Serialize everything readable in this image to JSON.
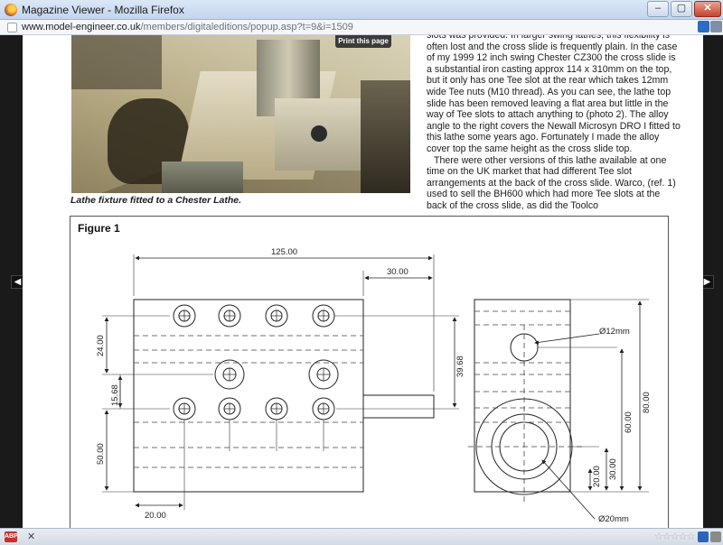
{
  "window": {
    "title": "Magazine Viewer - Mozilla Firefox",
    "minimize": "–",
    "maximize": "▢",
    "close": "✕"
  },
  "address": {
    "host": "www.model-engineer.co.uk",
    "path": "/members/digitaleditions/popup.asp?t=9&i=1509"
  },
  "viewer": {
    "prev_arrow": "◀",
    "next_arrow": "▶",
    "print_button": "Print this page",
    "photo_caption": "Lathe fixture fitted to a Chester Lathe.",
    "article_paragraphs": [
      "slots was provided. In larger swing lathes, this flexibility is often lost and the cross slide is frequently plain. In the case of my 1999 12 inch swing Chester CZ300 the cross slide is a substantial iron casting approx 114 x 310mm on the top, but it only has one Tee slot at the rear which takes 12mm wide Tee nuts (M10 thread). As you can see, the lathe top slide has been removed leaving a flat area but little in the way of Tee slots to attach anything to (photo 2). The alloy angle to the right covers the Newall Microsyn DRO I fitted to this lathe some years ago. Fortunately I made the alloy cover top the same height as the cross slide top.",
      "There were other versions of this lathe available at one time on the UK market that had different Tee slot arrangements at the back of the cross slide. Warco, (ref. 1) used to sell the BH600 which had more Tee slots at the back of the cross slide, as did the Toolco"
    ],
    "figure": {
      "title": "Figure 1",
      "dims": {
        "d125": "125.00",
        "d30": "30.00",
        "d24": "24.00",
        "d3968": "39.68",
        "d1568": "15.68",
        "d50": "50.00",
        "d20": "20.00",
        "d60": "60.00",
        "d80": "80.00",
        "d30b": "30.00",
        "d20b": "20.00",
        "phi12": "Ø12mm",
        "phi20": "Ø20mm"
      }
    }
  },
  "statusbar": {
    "abp": "ABP",
    "close": "✕",
    "stars": "☆☆☆☆☆"
  }
}
